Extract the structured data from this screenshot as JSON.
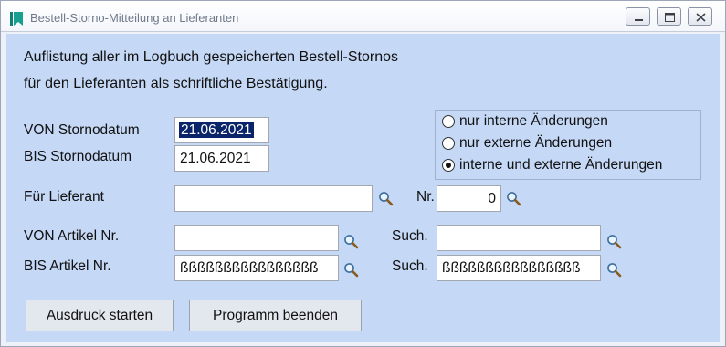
{
  "window": {
    "title": "Bestell-Storno-Mitteilung an Lieferanten",
    "controls": [
      "minimize-icon",
      "maximize-icon",
      "close-icon"
    ]
  },
  "intro": {
    "line1": "Auflistung aller im Logbuch gespeicherten Bestell-Stornos",
    "line2": "für den Lieferanten als schriftliche Bestätigung."
  },
  "date_from": {
    "label": "VON Stornodatum",
    "value": "21.06.2021",
    "selected": true
  },
  "date_to": {
    "label": "BIS Stornodatum",
    "value": "21.06.2021"
  },
  "change_filter": {
    "options": [
      {
        "label": "nur interne Änderungen",
        "checked": false
      },
      {
        "label": "nur externe Änderungen",
        "checked": false
      },
      {
        "label": "interne und externe Änderungen",
        "checked": true
      }
    ]
  },
  "supplier": {
    "label": "Für Lieferant",
    "value": "",
    "number_label": "Nr.",
    "number_value": "0"
  },
  "article_from": {
    "label": "VON Artikel Nr.",
    "value": "",
    "search_label": "Such.",
    "search_value": ""
  },
  "article_to": {
    "label": "BIS Artikel Nr.",
    "value": "ßßßßßßßßßßßßßßßß",
    "search_label": "Such.",
    "search_value": "ßßßßßßßßßßßßßßßß"
  },
  "buttons": {
    "print": {
      "before": "Ausdruck ",
      "mnemonic": "s",
      "after": "tarten"
    },
    "exit": {
      "before": "Programm be",
      "mnemonic": "e",
      "after": "nden"
    }
  },
  "colors": {
    "client_bg": "#c5d8f6",
    "selection": "#0a246a",
    "app_icon": "#1a9e8f"
  }
}
